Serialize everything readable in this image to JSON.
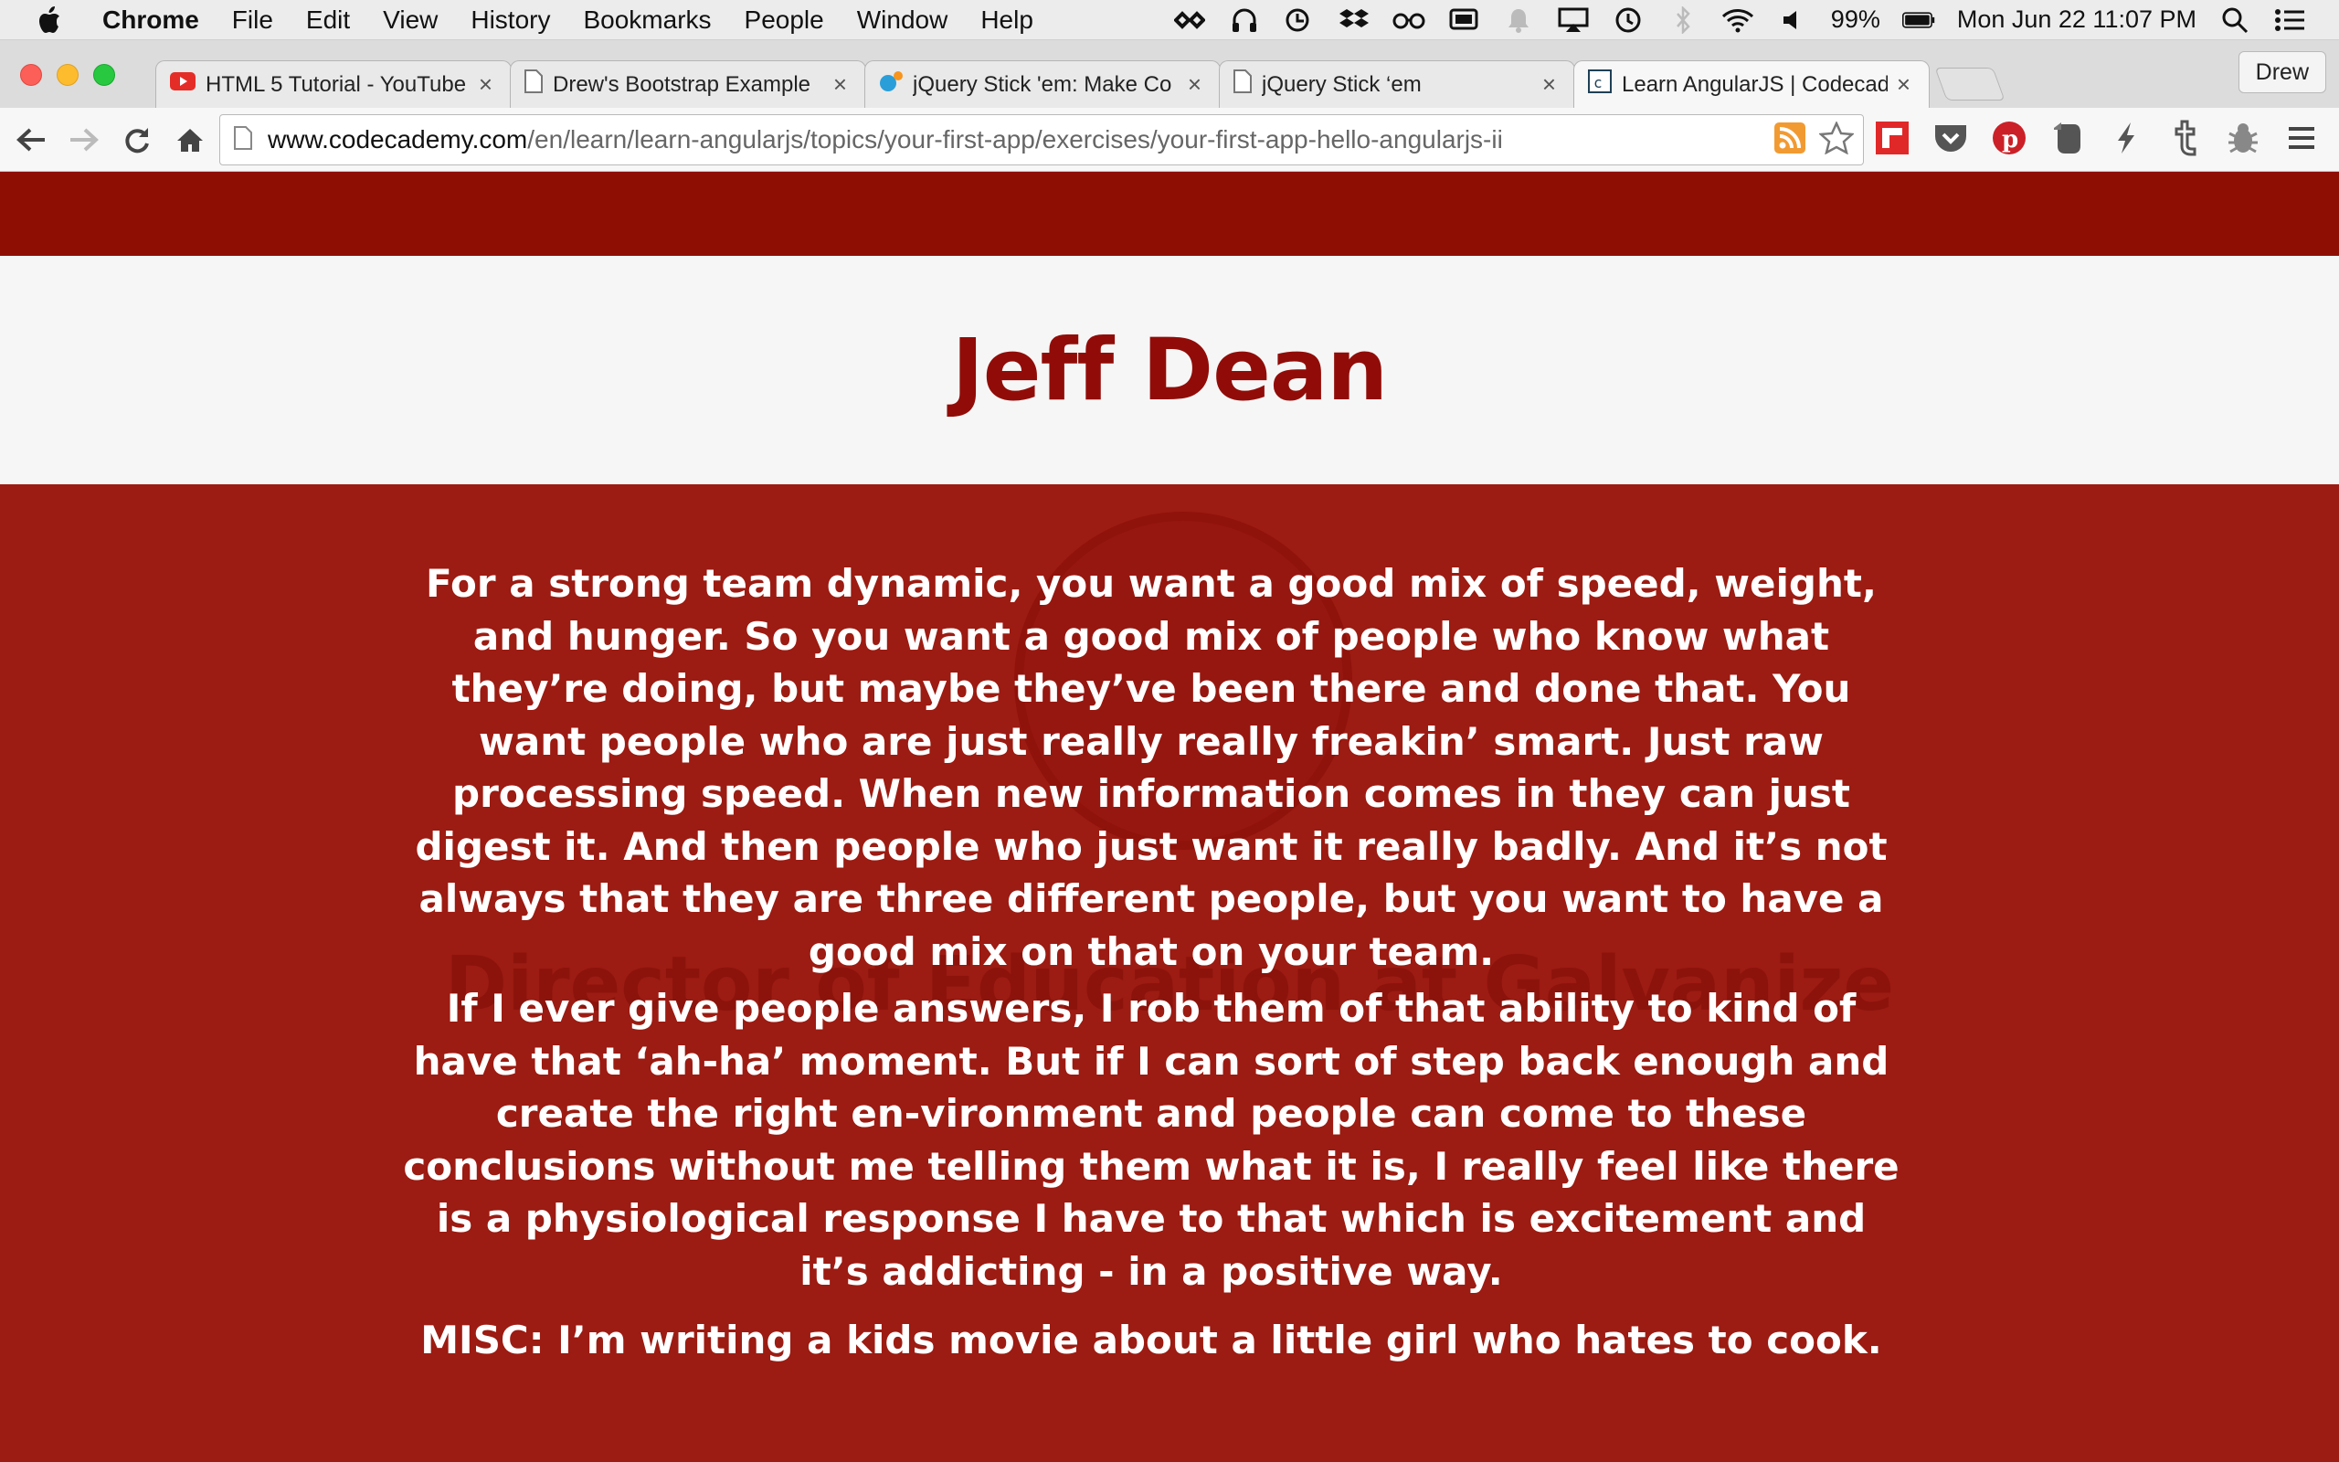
{
  "menubar": {
    "app": "Chrome",
    "items": [
      "File",
      "Edit",
      "View",
      "History",
      "Bookmarks",
      "People",
      "Window",
      "Help"
    ],
    "battery": "99%",
    "clock": "Mon Jun 22  11:07 PM"
  },
  "tabs": [
    {
      "label": "HTML 5 Tutorial - YouTube",
      "icon": "youtube-icon"
    },
    {
      "label": "Drew's Bootstrap Example",
      "icon": "page-icon"
    },
    {
      "label": "jQuery Stick 'em: Make Co",
      "icon": "jquery-icon"
    },
    {
      "label": "jQuery Stick ‘em",
      "icon": "page-icon"
    },
    {
      "label": "Learn AngularJS | Codecad",
      "icon": "codecademy-icon"
    }
  ],
  "profile": "Drew",
  "toolbar": {
    "url_host": "www.codecademy.com",
    "url_path": "/en/learn/learn-angularjs/topics/your-first-app/exercises/your-first-app-hello-angularjs-ii"
  },
  "page": {
    "name": "Jeff Dean",
    "background_title": "Director of Education at Galvanize",
    "quote_1": "For a strong team dynamic, you want a good mix of speed, weight, and hunger.  So you want a good mix of people who know what they’re doing, but maybe they’ve been there and done that. You want people who are just really really freakin’ smart.  Just raw processing speed.  When new information comes in they can just digest it.  And then people who just want it really badly.  And it’s not always that they are three different people, but you want to have a good mix on that on your team.",
    "quote_2": "If I ever give people answers, I rob them of that ability to kind of have that ‘ah-ha’ moment. But if I can sort of step back enough and create the right en-vironment and people can come to these conclusions without me telling them what it is, I really feel like there is a physiological response I have to that which is excitement and it’s addicting - in a positive way.",
    "misc": "MISC: I’m writing a kids movie about a little girl who hates to cook."
  },
  "colors": {
    "header_red": "#8f0e04",
    "quote_bg": "#9c1b12",
    "name_red": "#910c08"
  }
}
